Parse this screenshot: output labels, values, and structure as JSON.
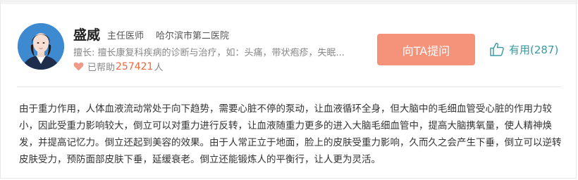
{
  "doctor": {
    "name": "盛威",
    "title": "主任医师",
    "hospital": "哈尔滨市第二医院",
    "specialty": "擅长: 擅长康复科疾病的诊断与治疗，如：头痛，带状疱疹，失眠...",
    "helped_prefix": "已帮助",
    "helped_count": "257421",
    "helped_suffix": "人"
  },
  "actions": {
    "ask_label": "向TA提问",
    "useful_label": "有用(287)"
  },
  "answer": {
    "text": "由于重力作用，人体血液流动常处于向下趋势，需要心脏不停的泵动，让血液循环全身，但大脑中的毛细血管受心脏的作用力较小，因此受重力影响较大，倒立可以对重力进行反转，让血液随重力更多的进入大脑毛细血管中，提高大脑携氧量，使人精神焕发，并提高记忆力。倒立还起到美容的效果。由于人常正立于地面，脸上的皮肤受重力影响，久而久之会产生下垂，倒立可以逆转皮肤受力，预防面部皮肤下垂，延缓衰老。倒立还能锻炼人的平衡行，让人更为灵活。"
  },
  "colors": {
    "accent_button": "#f4937a",
    "helped_count": "#ec6a3e",
    "useful": "#3a9aa0"
  },
  "icons": {
    "heart": "heart-icon",
    "thumb": "thumbs-up-icon"
  }
}
